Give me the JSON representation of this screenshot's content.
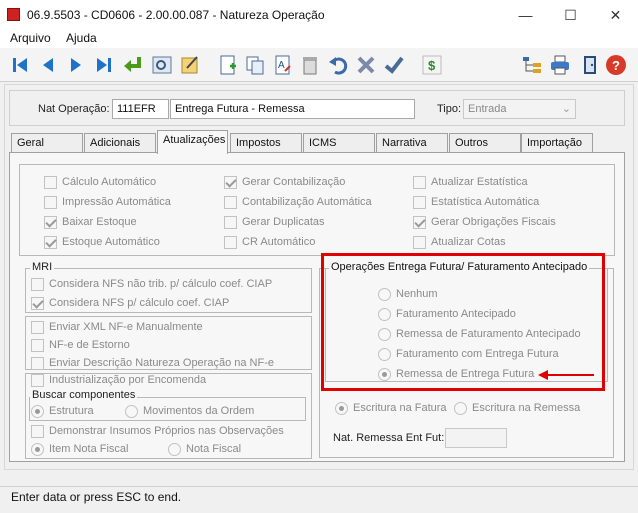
{
  "window": {
    "title": "06.9.5503 - CD0606 - 2.00.00.087 - Natureza Operação",
    "minimize": "—",
    "maximize": "☐",
    "close": "✕"
  },
  "menu": [
    "Arquivo",
    "Ajuda"
  ],
  "toolbar_icons": [
    "first-record-icon",
    "previous-record-icon",
    "next-record-icon",
    "last-record-icon",
    "return-icon",
    "search-icon",
    "edit-icon",
    "new-record-icon",
    "copy-record-icon",
    "clear-field-icon",
    "delete-icon",
    "undo-icon",
    "cancel-icon",
    "confirm-icon",
    "money-icon",
    "tree-icon",
    "print-icon",
    "exit-icon",
    "help-icon"
  ],
  "header": {
    "nat_label": "Nat Operação:",
    "nat_code": "111EFR",
    "nat_desc": "Entrega Futura - Remessa",
    "tipo_label": "Tipo:",
    "tipo_value": "Entrada"
  },
  "tabs": [
    "Geral",
    "Adicionais",
    "Atualizações",
    "Impostos",
    "ICMS",
    "Narrativa",
    "Outros",
    "Importação"
  ],
  "active_tab": "Atualizações",
  "top_checks": {
    "col1": [
      {
        "label": "Cálculo Automático",
        "checked": false
      },
      {
        "label": "Impressão Automática",
        "checked": false
      },
      {
        "label": "Baixar Estoque",
        "checked": true
      },
      {
        "label": "Estoque Automático",
        "checked": true
      }
    ],
    "col2": [
      {
        "label": "Gerar Contabilização",
        "checked": true
      },
      {
        "label": "Contabilização Automática",
        "checked": false
      },
      {
        "label": "Gerar Duplicatas",
        "checked": false
      },
      {
        "label": "CR Automático",
        "checked": false
      }
    ],
    "col3": [
      {
        "label": "Atualizar Estatística",
        "checked": false
      },
      {
        "label": "Estatística Automática",
        "checked": false
      },
      {
        "label": "Gerar Obrigações Fiscais",
        "checked": true
      },
      {
        "label": "Atualizar Cotas",
        "checked": false
      }
    ]
  },
  "mri": {
    "title": "MRI",
    "items": [
      {
        "label": "Considera NFS não trib. p/ cálculo coef. CIAP",
        "checked": false
      },
      {
        "label": "Considera NFS p/ cálculo coef. CIAP",
        "checked": true
      }
    ]
  },
  "nfe": [
    {
      "label": "Enviar XML NF-e Manualmente",
      "checked": false
    },
    {
      "label": "NF-e de Estorno",
      "checked": false
    },
    {
      "label": "Enviar Descrição Natureza Operação na NF-e",
      "checked": false
    }
  ],
  "industrializacao": {
    "label": "Industrialização por Encomenda",
    "buscar_title": "Buscar componentes",
    "buscar_options": [
      "Estrutura",
      "Movimentos da Ordem"
    ],
    "buscar_selected": "Estrutura",
    "demonstrar": "Demonstrar Insumos Próprios nas Observações",
    "item_options": [
      "Item Nota Fiscal",
      "Nota Fiscal"
    ],
    "item_selected": "Item Nota Fiscal"
  },
  "entrega_futura": {
    "title": "Operações Entrega Futura/ Faturamento Antecipado",
    "options": [
      "Nenhum",
      "Faturamento Antecipado",
      "Remessa de Faturamento Antecipado",
      "Faturamento com Entrega Futura",
      "Remessa de Entrega Futura"
    ],
    "selected": "Remessa de Entrega Futura"
  },
  "escritura": {
    "options": [
      "Escritura na Fatura",
      "Escritura na Remessa"
    ],
    "selected": "Escritura na Fatura"
  },
  "nat_remessa": {
    "label": "Nat. Remessa Ent Fut:",
    "value": ""
  },
  "status": "Enter data or press ESC to end.",
  "colors": {
    "highlight": "#e00000",
    "accent": "#1e72c8"
  }
}
